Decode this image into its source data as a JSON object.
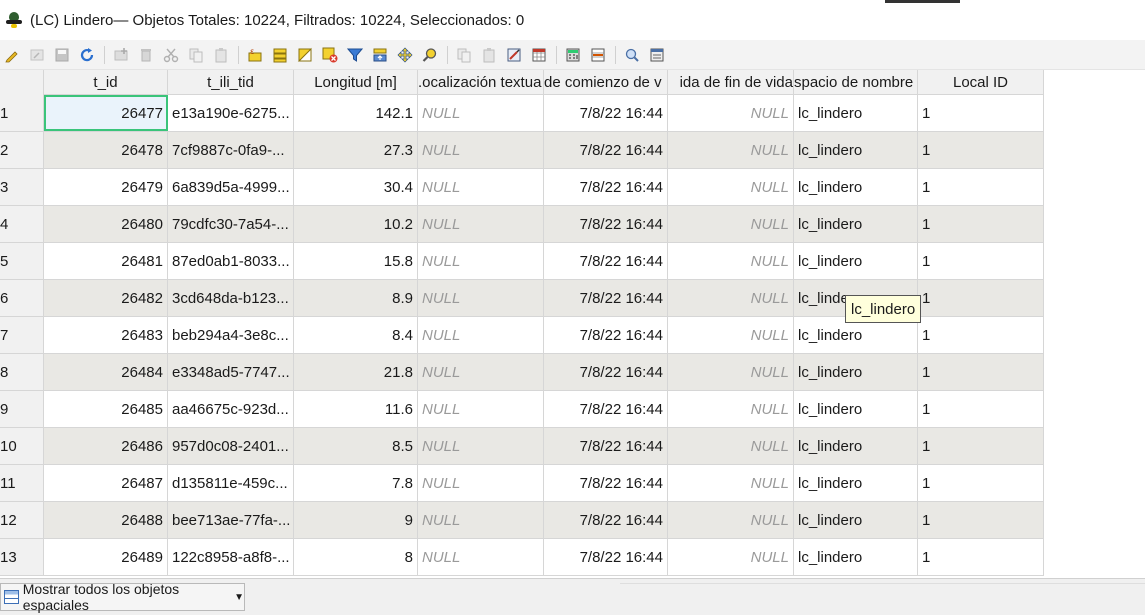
{
  "window": {
    "title": "(LC) Lindero— Objetos Totales: 10224, Filtrados: 10224, Seleccionados: 0"
  },
  "toolbar": {
    "icons": [
      "toggle-editing-icon",
      "multi-edit-icon",
      "save-edits-icon",
      "reload-icon",
      "add-feature-icon",
      "delete-feature-icon",
      "cut-icon",
      "copy-icon",
      "paste-icon",
      "select-expression-icon",
      "select-all-icon",
      "invert-selection-icon",
      "deselect-all-icon",
      "filter-select-icon",
      "move-selection-top-icon",
      "pan-to-selected-icon",
      "zoom-to-selected-icon",
      "copy-rows-icon",
      "paste-rows-icon",
      "new-field-icon",
      "delete-field-icon",
      "field-calculator-icon",
      "conditional-formatting-icon",
      "dock-table-icon"
    ]
  },
  "table": {
    "columns": [
      "t_id",
      "t_ili_tid",
      "Longitud [m]",
      ".ocalización textua",
      "de comienzo de v",
      "ida de fin de vida",
      "spacio de nombre",
      "Local ID"
    ],
    "rows": [
      {
        "num": "1",
        "t_id": "26477",
        "t_ili_tid": "e13a190e-6275...",
        "longitud": "142.1",
        "localizacion": "NULL",
        "comienzo": "7/8/22 16:44",
        "fin": "NULL",
        "espacio": "lc_lindero",
        "local_id": "1"
      },
      {
        "num": "2",
        "t_id": "26478",
        "t_ili_tid": "7cf9887c-0fa9-...",
        "longitud": "27.3",
        "localizacion": "NULL",
        "comienzo": "7/8/22 16:44",
        "fin": "NULL",
        "espacio": "lc_lindero",
        "local_id": "1"
      },
      {
        "num": "3",
        "t_id": "26479",
        "t_ili_tid": "6a839d5a-4999...",
        "longitud": "30.4",
        "localizacion": "NULL",
        "comienzo": "7/8/22 16:44",
        "fin": "NULL",
        "espacio": "lc_lindero",
        "local_id": "1"
      },
      {
        "num": "4",
        "t_id": "26480",
        "t_ili_tid": "79cdfc30-7a54-...",
        "longitud": "10.2",
        "localizacion": "NULL",
        "comienzo": "7/8/22 16:44",
        "fin": "NULL",
        "espacio": "lc_lindero",
        "local_id": "1"
      },
      {
        "num": "5",
        "t_id": "26481",
        "t_ili_tid": "87ed0ab1-8033...",
        "longitud": "15.8",
        "localizacion": "NULL",
        "comienzo": "7/8/22 16:44",
        "fin": "NULL",
        "espacio": "lc_lindero",
        "local_id": "1"
      },
      {
        "num": "6",
        "t_id": "26482",
        "t_ili_tid": "3cd648da-b123...",
        "longitud": "8.9",
        "localizacion": "NULL",
        "comienzo": "7/8/22 16:44",
        "fin": "NULL",
        "espacio": "lc_linde",
        "local_id": "1"
      },
      {
        "num": "7",
        "t_id": "26483",
        "t_ili_tid": "beb294a4-3e8c...",
        "longitud": "8.4",
        "localizacion": "NULL",
        "comienzo": "7/8/22 16:44",
        "fin": "NULL",
        "espacio": "lc_lindero",
        "local_id": "1"
      },
      {
        "num": "8",
        "t_id": "26484",
        "t_ili_tid": "e3348ad5-7747...",
        "longitud": "21.8",
        "localizacion": "NULL",
        "comienzo": "7/8/22 16:44",
        "fin": "NULL",
        "espacio": "lc_lindero",
        "local_id": "1"
      },
      {
        "num": "9",
        "t_id": "26485",
        "t_ili_tid": "aa46675c-923d...",
        "longitud": "11.6",
        "localizacion": "NULL",
        "comienzo": "7/8/22 16:44",
        "fin": "NULL",
        "espacio": "lc_lindero",
        "local_id": "1"
      },
      {
        "num": "10",
        "t_id": "26486",
        "t_ili_tid": "957d0c08-2401...",
        "longitud": "8.5",
        "localizacion": "NULL",
        "comienzo": "7/8/22 16:44",
        "fin": "NULL",
        "espacio": "lc_lindero",
        "local_id": "1"
      },
      {
        "num": "11",
        "t_id": "26487",
        "t_ili_tid": "d135811e-459c...",
        "longitud": "7.8",
        "localizacion": "NULL",
        "comienzo": "7/8/22 16:44",
        "fin": "NULL",
        "espacio": "lc_lindero",
        "local_id": "1"
      },
      {
        "num": "12",
        "t_id": "26488",
        "t_ili_tid": "bee713ae-77fa-...",
        "longitud": "9",
        "localizacion": "NULL",
        "comienzo": "7/8/22 16:44",
        "fin": "NULL",
        "espacio": "lc_lindero",
        "local_id": "1"
      },
      {
        "num": "13",
        "t_id": "26489",
        "t_ili_tid": "122c8958-a8f8-...",
        "longitud": "8",
        "localizacion": "NULL",
        "comienzo": "7/8/22 16:44",
        "fin": "NULL",
        "espacio": "lc_lindero",
        "local_id": "1"
      }
    ]
  },
  "tooltip": {
    "text": "lc_lindero"
  },
  "footer": {
    "filter_label": "Mostrar todos los objetos espaciales"
  }
}
